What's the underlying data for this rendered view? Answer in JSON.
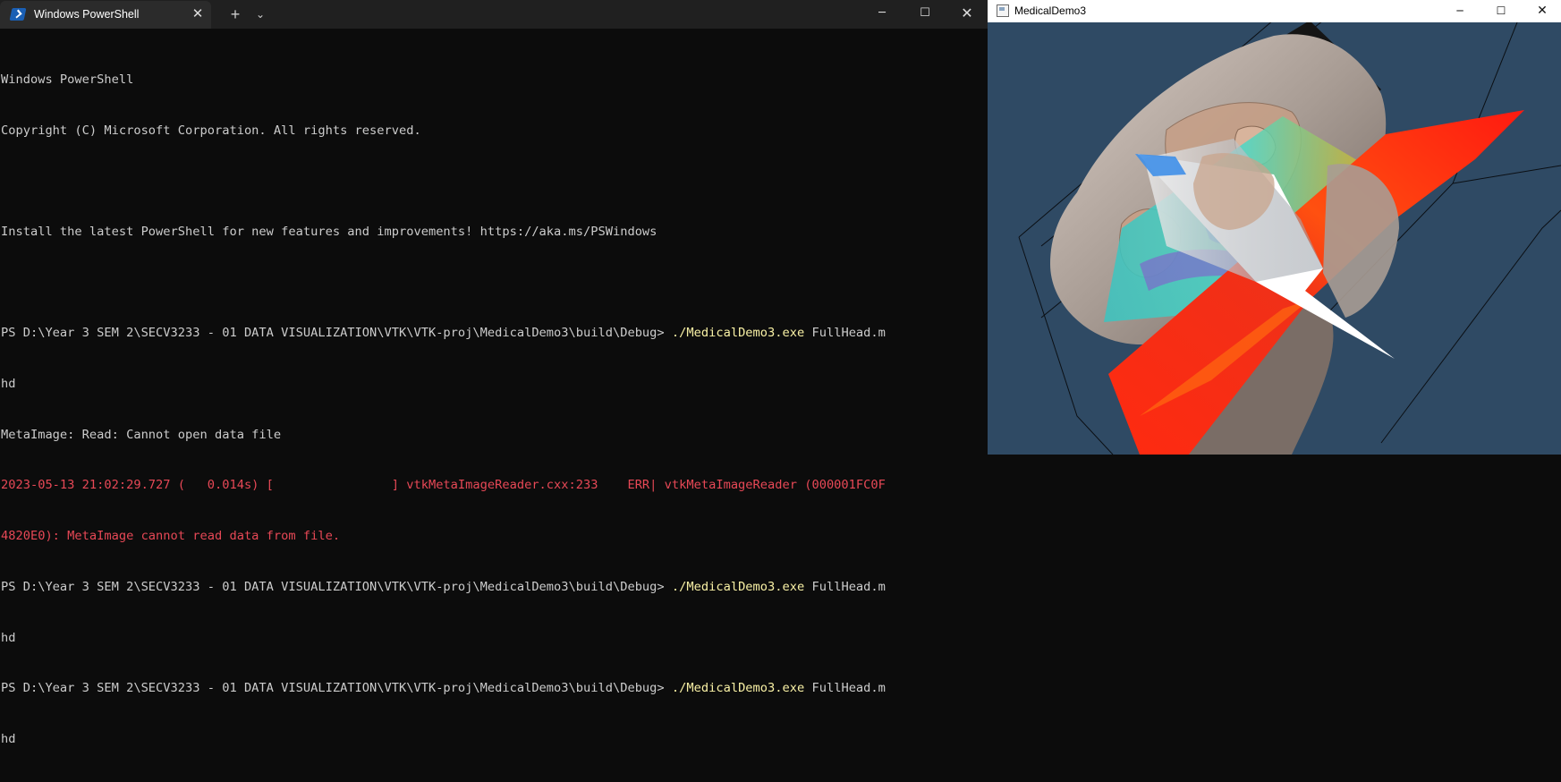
{
  "powershell": {
    "tab_title": "Windows PowerShell",
    "icons": {
      "tab": "powershell-icon",
      "close_tab": "close-icon",
      "new_tab": "plus-icon",
      "dropdown": "chevron-down-icon"
    },
    "window_buttons": {
      "minimize": "─",
      "maximize": "☐",
      "close": "✕"
    },
    "console": {
      "banner1": "Windows PowerShell",
      "banner2": "Copyright (C) Microsoft Corporation. All rights reserved.",
      "install_msg": "Install the latest PowerShell for new features and improvements! https://aka.ms/PSWindows",
      "prompt": "PS D:\\Year 3 SEM 2\\SECV3233 - 01 DATA VISUALIZATION\\VTK\\VTK-proj\\MedicalDemo3\\build\\Debug> ",
      "command": "./MedicalDemo3.exe",
      "arg1": " FullHead.m",
      "arg2": "hd",
      "metaimage_msg": "MetaImage: Read: Cannot open data file",
      "error1": "2023-05-13 21:02:29.727 (   0.014s) [                ] vtkMetaImageReader.cxx:233    ERR| vtkMetaImageReader (000001FC0F",
      "error2": "4820E0): MetaImage cannot read data from file."
    }
  },
  "medicaldemo": {
    "title": "MedicalDemo3",
    "app_icon": "app-window-icon",
    "window_buttons": {
      "minimize": "─",
      "maximize": "☐",
      "close": "✕"
    },
    "render": {
      "background": "#2f4a64",
      "skin": "#b8aca4",
      "bone": "#c8a48c",
      "plane_red": "#f02010",
      "plane_white": "#ffffff",
      "plane_cyan": "#3ecfc0"
    }
  }
}
